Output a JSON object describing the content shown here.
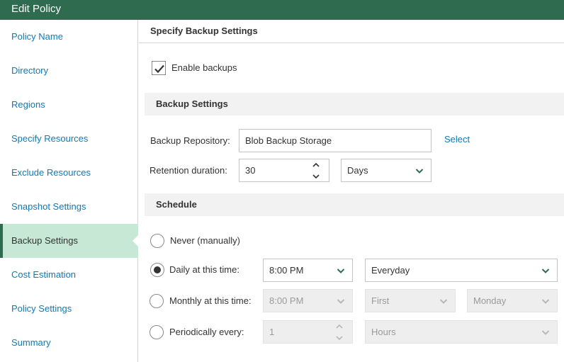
{
  "window": {
    "title": "Edit Policy"
  },
  "sidebar": {
    "items": [
      {
        "label": "Policy Name",
        "active": false
      },
      {
        "label": "Directory",
        "active": false
      },
      {
        "label": "Regions",
        "active": false
      },
      {
        "label": "Specify Resources",
        "active": false
      },
      {
        "label": "Exclude Resources",
        "active": false
      },
      {
        "label": "Snapshot Settings",
        "active": false
      },
      {
        "label": "Backup Settings",
        "active": true
      },
      {
        "label": "Cost Estimation",
        "active": false
      },
      {
        "label": "Policy Settings",
        "active": false
      },
      {
        "label": "Summary",
        "active": false
      }
    ]
  },
  "main": {
    "heading": "Specify Backup Settings",
    "enable_backups": {
      "label": "Enable backups",
      "checked": true
    },
    "backup_settings": {
      "title": "Backup Settings",
      "repository_label": "Backup Repository:",
      "repository_value": "Blob Backup Storage",
      "select_link": "Select",
      "retention_label": "Retention duration:",
      "retention_value": "30",
      "retention_unit": "Days"
    },
    "schedule": {
      "title": "Schedule",
      "never": {
        "label": "Never (manually)",
        "checked": false
      },
      "daily": {
        "label": "Daily at this time:",
        "checked": true,
        "time": "8:00 PM",
        "days": "Everyday"
      },
      "monthly": {
        "label": "Monthly at this time:",
        "checked": false,
        "time": "8:00 PM",
        "week": "First",
        "day": "Monday"
      },
      "periodic": {
        "label": "Periodically every:",
        "checked": false,
        "value": "1",
        "unit": "Hours"
      }
    }
  },
  "colors": {
    "title_bar": "#2e6b4f",
    "active_nav": "#c6e8d5",
    "link": "#0f7ab8",
    "band": "#f2f2f2"
  }
}
